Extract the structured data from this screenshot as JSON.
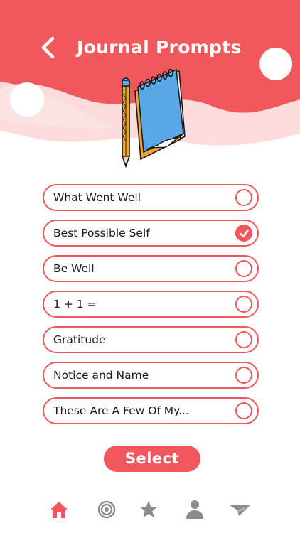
{
  "header": {
    "title": "Journal Prompts",
    "back_icon": "chevron-left-icon"
  },
  "illustration": {
    "icon": "notebook-pencil-illustration"
  },
  "prompts": [
    {
      "label": "What Went Well",
      "selected": false
    },
    {
      "label": "Best Possible Self",
      "selected": true
    },
    {
      "label": "Be Well",
      "selected": false
    },
    {
      "label": "1 + 1 =",
      "selected": false
    },
    {
      "label": "Gratitude",
      "selected": false
    },
    {
      "label": "Notice and Name",
      "selected": false
    },
    {
      "label": "These Are A Few Of My...",
      "selected": false
    }
  ],
  "select_button": {
    "label": "Select"
  },
  "bottom_nav": {
    "items": [
      {
        "icon": "home-icon",
        "active": true
      },
      {
        "icon": "target-icon",
        "active": false
      },
      {
        "icon": "star-icon",
        "active": false
      },
      {
        "icon": "person-icon",
        "active": false
      },
      {
        "icon": "paper-plane-icon",
        "active": false
      }
    ]
  },
  "colors": {
    "accent": "#f0585b",
    "header_light": "#fcdcdc",
    "nav_inactive": "#8c8c8c",
    "text": "#1a1a1a"
  }
}
